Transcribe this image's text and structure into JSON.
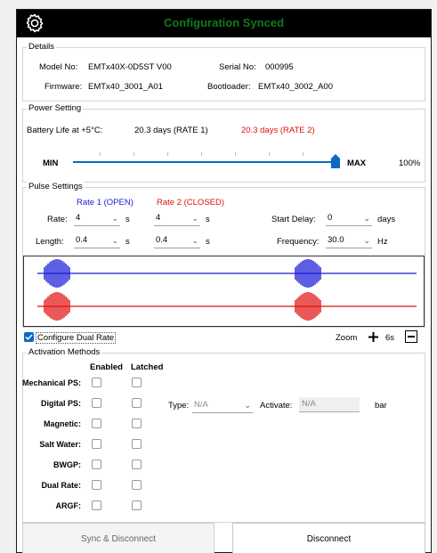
{
  "header": {
    "title": "Configuration Synced",
    "gear_icon": "gear-icon"
  },
  "details": {
    "legend": "Details",
    "model_label": "Model No:",
    "model_value": "EMTx40X-0D5ST  V00",
    "serial_label": "Serial No:",
    "serial_value": "000995",
    "firmware_label": "Firmware:",
    "firmware_value": "EMTx40_3001_A01",
    "bootloader_label": "Bootloader:",
    "bootloader_value": "EMTx40_3002_A00"
  },
  "power": {
    "legend": "Power Setting",
    "battery_label": "Battery Life at +5°C:",
    "rate1_life": "20.3 days (RATE 1)",
    "rate2_life": "20.3 days (RATE 2)",
    "min_label": "MIN",
    "max_label": "MAX",
    "percent": "100%",
    "slider_level": 1.0
  },
  "pulse": {
    "legend": "Pulse Settings",
    "rate1_header": "Rate 1 (OPEN)",
    "rate2_header": "Rate 2 (CLOSED)",
    "rate_label": "Rate:",
    "rate1_value": "4",
    "rate2_value": "4",
    "rate_unit": "s",
    "length_label": "Length:",
    "length1_value": "0.4",
    "length2_value": "0.4",
    "length_unit": "s",
    "start_delay_label": "Start Delay:",
    "start_delay_value": "0",
    "start_delay_unit": "days",
    "frequency_label": "Frequency:",
    "frequency_value": "30.0",
    "frequency_unit": "Hz",
    "blue_color": "#1a1ad8",
    "red_color": "#e01010"
  },
  "dual_rate": {
    "label": "Configure Dual Rate",
    "checked": true,
    "zoom_label": "Zoom",
    "zoom_value": "6s",
    "plus_icon": "plus-icon",
    "minus_icon": "minus-icon"
  },
  "activation": {
    "legend": "Activation Methods",
    "enabled_header": "Enabled",
    "latched_header": "Latched",
    "rows": [
      "Mechanical PS:",
      "Digital PS:",
      "Magnetic:",
      "Salt Water:",
      "BWGP:",
      "Dual Rate:",
      "ARGF:"
    ],
    "type_label": "Type:",
    "type_value": "N/A",
    "activate_label": "Activate:",
    "activate_value": "N/A",
    "activate_unit": "bar"
  },
  "buttons": {
    "sync_disconnect": "Sync & Disconnect",
    "disconnect": "Disconnect"
  }
}
